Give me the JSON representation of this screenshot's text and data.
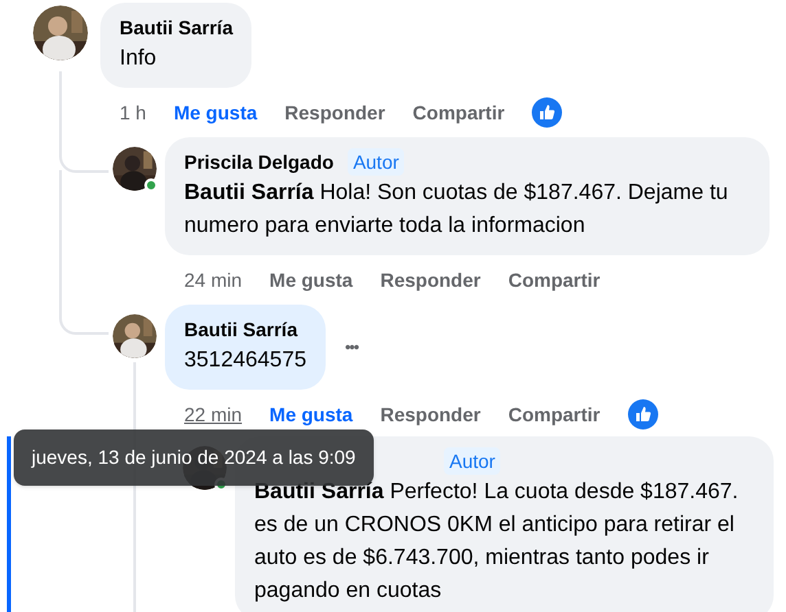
{
  "comments": [
    {
      "author": "Bautii Sarría",
      "text": "Info",
      "time": "1 h",
      "time_hovered": false,
      "liked": true,
      "reaction": true,
      "online": false,
      "own": false,
      "actions": [
        "Me gusta",
        "Responder",
        "Compartir"
      ],
      "children": [
        {
          "author": "Priscila Delgado",
          "badge": "Autor",
          "text": "**Bautii Sarría** Hola! Son cuotas de $187.467. Dejame tu numero para enviarte toda la informacion",
          "time": "24 min",
          "time_hovered": false,
          "liked": false,
          "reaction": false,
          "online": true,
          "own": false,
          "actions": [
            "Me gusta",
            "Responder",
            "Compartir"
          ]
        },
        {
          "author": "Bautii Sarría",
          "text": "3512464575",
          "time": "22 min",
          "time_hovered": true,
          "liked": true,
          "reaction": true,
          "online": false,
          "own": true,
          "menu_icon": "•••",
          "actions": [
            "Me gusta",
            "Responder",
            "Compartir"
          ],
          "children": [
            {
              "badge": "Autor",
              "text": "**Bautii Sarría** Perfecto! La cuota desde $187.467. es de un CRONOS 0KM el anticipo para retirar el auto es de $6.743.700, mientras tanto podes ir pagando en cuotas",
              "online": true,
              "own": false,
              "focused": true
            }
          ]
        }
      ]
    }
  ],
  "tooltip": {
    "text": "jueves, 13 de junio de 2024 a las 9:09"
  }
}
